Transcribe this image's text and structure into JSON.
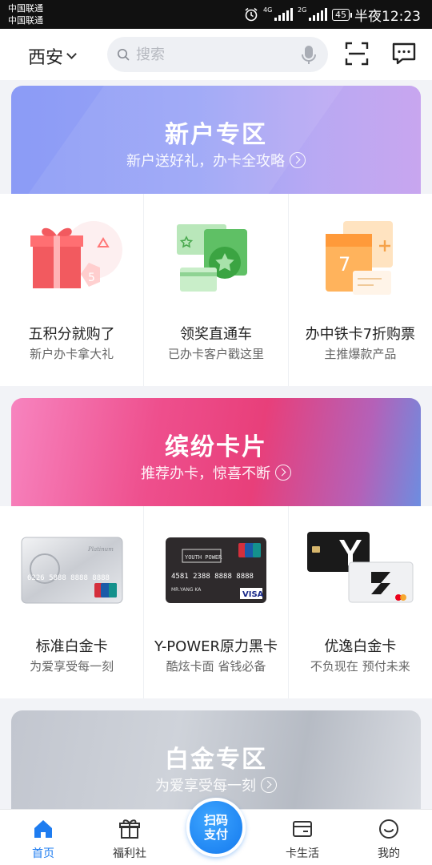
{
  "status_bar": {
    "carrier_1": "中国联通",
    "carrier_2": "中国联通",
    "network_1": "4G",
    "network_2": "2G",
    "battery": "45",
    "time": "半夜12:23"
  },
  "header": {
    "city": "西安",
    "search_placeholder": "搜索",
    "icons": [
      "chevron-down-icon",
      "search-icon",
      "microphone-icon",
      "scan-icon",
      "message-icon"
    ]
  },
  "banners": [
    {
      "title": "新户专区",
      "subtitle": "新户送好礼，办卡全攻略"
    },
    {
      "title": "缤纷卡片",
      "subtitle": "推荐办卡，惊喜不断"
    },
    {
      "title": "白金专区",
      "subtitle": "为爱享受每一刻"
    }
  ],
  "new_user_items": [
    {
      "title": "五积分就购了",
      "desc": "新户办卡拿大礼",
      "icon": "gift-icon"
    },
    {
      "title": "领奖直通车",
      "desc": "已办卡客户戳这里",
      "icon": "reward-cards-icon"
    },
    {
      "title": "办中铁卡7折购票",
      "desc": "主推爆款产品",
      "icon": "discount-ticket-icon"
    }
  ],
  "card_items": [
    {
      "title": "标准白金卡",
      "desc": "为爱享受每一刻",
      "icon": "platinum-card-image"
    },
    {
      "title": "Y-POWER原力黑卡",
      "desc": "酷炫卡面 省钱必备",
      "icon": "black-card-image"
    },
    {
      "title": "优逸白金卡",
      "desc": "不负现在 预付未来",
      "icon": "youyi-card-image"
    }
  ],
  "card_art": {
    "platinum_number": "6226 5888 8888 8888",
    "platinum_script": "Platinum",
    "black_number": "4581 2388 8888 8888",
    "black_name": "MR.YANG KA",
    "black_brand": "VISA",
    "black_badge": "YOUTH POWER",
    "unionpay": "UnionPay"
  },
  "bottom_nav": {
    "items": [
      {
        "label": "首页",
        "icon": "home-icon",
        "active": true
      },
      {
        "label": "福利社",
        "icon": "gift-box-icon",
        "active": false
      },
      {
        "label": "卡生活",
        "icon": "card-wallet-icon",
        "active": false
      },
      {
        "label": "我的",
        "icon": "smile-icon",
        "active": false
      }
    ],
    "scan_pay_line1": "扫码",
    "scan_pay_line2": "支付"
  },
  "colors": {
    "accent": "#1e7cf0",
    "banner_new_user": "#8b9bf6",
    "banner_cards": "#e83f7a",
    "banner_platinum": "#c2c6cf"
  }
}
